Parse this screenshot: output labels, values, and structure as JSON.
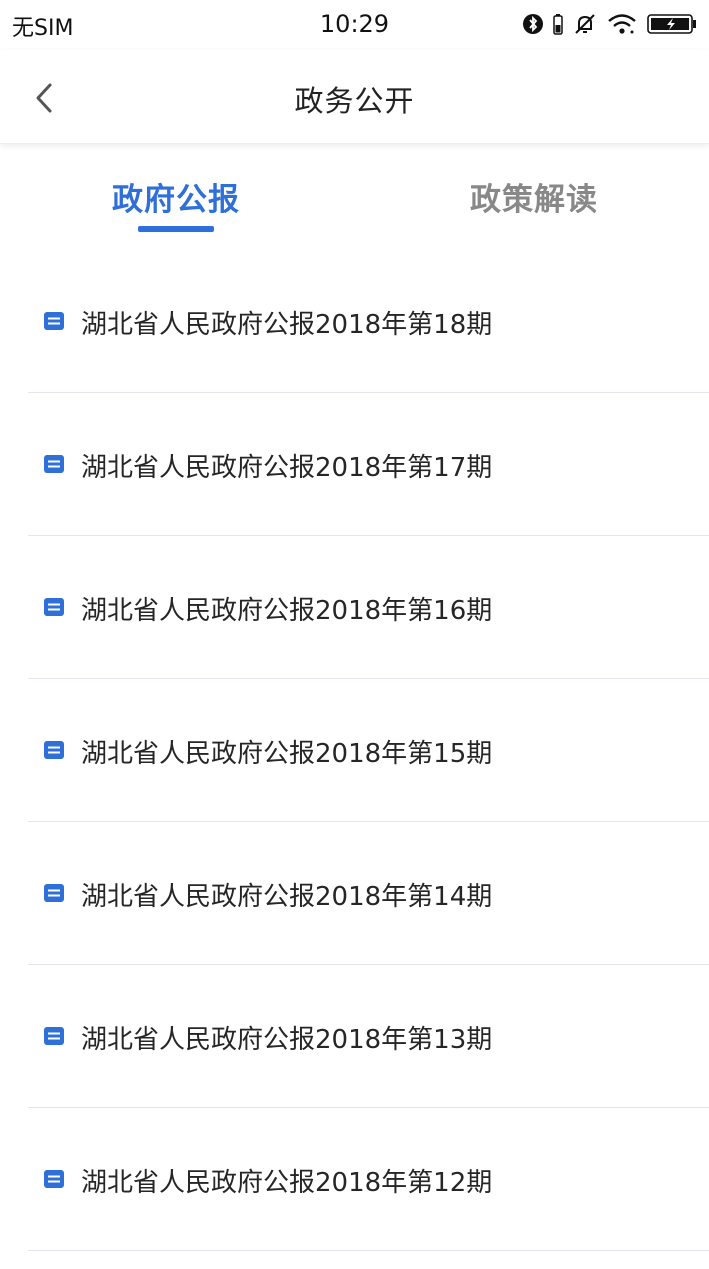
{
  "status_bar": {
    "carrier": "无SIM",
    "time": "10:29",
    "icons": [
      "bluetooth-icon",
      "battery-small-icon",
      "mute-bell-icon",
      "wifi-icon",
      "battery-charging-icon"
    ]
  },
  "nav": {
    "title": "政务公开",
    "back_icon": "chevron-left-icon"
  },
  "tabs": [
    {
      "label": "政府公报",
      "active": true
    },
    {
      "label": "政策解读",
      "active": false
    }
  ],
  "colors": {
    "accent": "#2e6fd8",
    "inactive_tab": "#888888",
    "divider": "#e4e6ef"
  },
  "list": {
    "item_icon": "document-icon",
    "items": [
      {
        "title": "湖北省人民政府公报2018年第18期"
      },
      {
        "title": "湖北省人民政府公报2018年第17期"
      },
      {
        "title": "湖北省人民政府公报2018年第16期"
      },
      {
        "title": "湖北省人民政府公报2018年第15期"
      },
      {
        "title": "湖北省人民政府公报2018年第14期"
      },
      {
        "title": "湖北省人民政府公报2018年第13期"
      },
      {
        "title": "湖北省人民政府公报2018年第12期"
      }
    ]
  }
}
